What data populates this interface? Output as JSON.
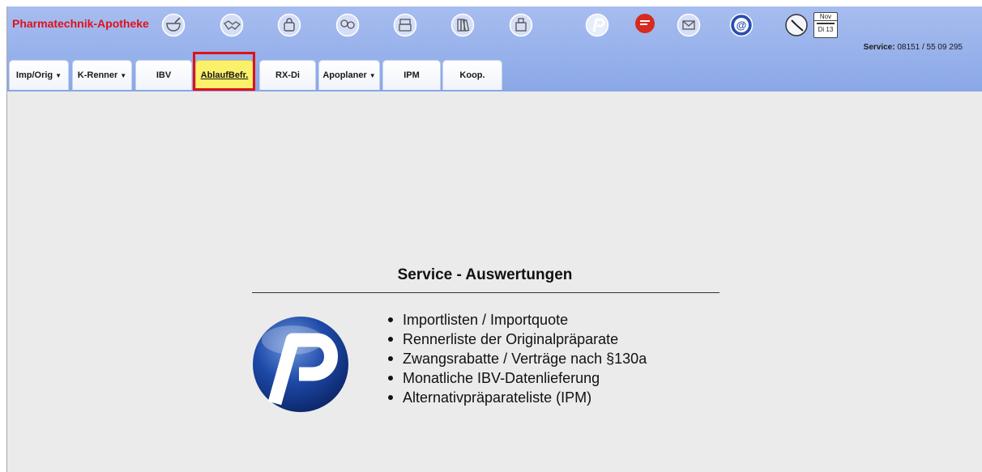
{
  "header": {
    "brand": "Pharmatechnik-Apotheke",
    "service_label": "Service:",
    "service_phone": "08151 / 55 09 295",
    "calendar": {
      "month": "Nov",
      "day": "Di 13"
    },
    "icons": [
      "mortar-icon",
      "handshake-icon",
      "shopping-bag-icon",
      "faces-icon",
      "printer-icon",
      "binders-icon",
      "cash-register-icon",
      "pharmatechnik-p-icon",
      "chat-bubble-icon",
      "envelope-icon",
      "at-sign-icon",
      "clock-icon",
      "calendar-icon"
    ]
  },
  "tabs": [
    {
      "label": "Imp/Orig",
      "dropdown": true
    },
    {
      "label": "K-Renner",
      "dropdown": true
    },
    {
      "label": "IBV",
      "dropdown": false
    },
    {
      "label": "AblaufBefr.",
      "dropdown": false,
      "active": true
    },
    {
      "label": "RX-Di",
      "dropdown": false
    },
    {
      "label": "Apoplaner",
      "dropdown": true
    },
    {
      "label": "IPM",
      "dropdown": false
    },
    {
      "label": "Koop.",
      "dropdown": false
    }
  ],
  "highlight_color": "#e0101a",
  "active_tab_color": "#faf06a",
  "main": {
    "title": "Service - Auswertungen",
    "items": [
      "Importlisten / Importquote",
      "Rennerliste der Originalpräparate",
      "Zwangsrabatte / Verträge nach §130a",
      "Monatliche IBV-Datenlieferung",
      "Alternativpräparateliste (IPM)"
    ]
  }
}
